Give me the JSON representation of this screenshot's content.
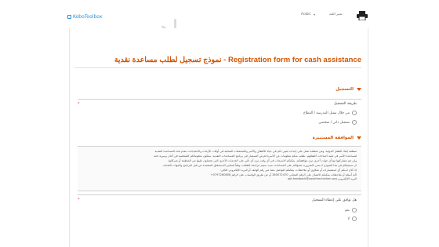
{
  "header": {
    "logo_text": "KoboToolbox",
    "watermark": "ماهو",
    "language_label": "Arabic",
    "language_select_label": "تغيير اللغة",
    "print_icon": "printer-icon"
  },
  "form": {
    "title": "نموذج تسجيل لطلب مساعدة نقدية - Registration form for cash assistance",
    "group1": {
      "title": "التسجيل",
      "question_label": "طريقة التسجيل",
      "options": [
        "من خلال ممثل المدرسة / القطاع",
        "تسجيل ذاتي / شخصي"
      ]
    },
    "group2": {
      "title": "الموافقة المستنيرة",
      "consent_lines": [
        "منظمة إنقاذ الطفل الدولية، وهي منظمة تعمل على إحداث تغيير دائم في حياة الأطفال والأسر والمجتمعات المحلية في أوقات الأزمات والاحتياجات، تقدم هذه المساعدة النقدية",
        "لمساعدة الأسر في تلبية احتياجات أطفالهم. نطلب منكم معلومات عن الأسرة لغرض التسجيل في برنامج المساعدات النقدية. ستكون معلوماتكم الشخصية في أمان وسرية تامة",
        "ولن تتم مشاركتها مع أي جهات أخرى دون موافقتكم. يمكنكم الانسحاب في أي وقت دون أي تأثير على الخدمات الأخرى التي تحصلون عليها من المنظمة أو شركائها.",
        "ان تسجيلكم في هذا النموذج لا يعني بالضرورة حصولكم على المساعدة، حيث سيتم مراجعة الطلبات وفقاً لمعايير الاستحقاق المعتمدة من قبل البرنامج والجهات المانحة.",
        "إذا كان لديكم أي استفسارات أو شكاوى أو ملاحظات، يمكنكم التواصل معنا عبر رقم الهاتف أو البريد الإلكتروني التالي:",
        "لأية أسئلة أو ملاحظات يمكنكم الاتصال على الرقم المجاني 180072470 أو عن طريق الواتساب على الرقم 0797280808+"
      ],
      "consent_contact": "opt.feedback@savethechildren.org البريد الإلكتروني",
      "question_label": "هل توافق على إعطاء التسجيل",
      "options": [
        "نعم",
        "لا"
      ]
    }
  }
}
